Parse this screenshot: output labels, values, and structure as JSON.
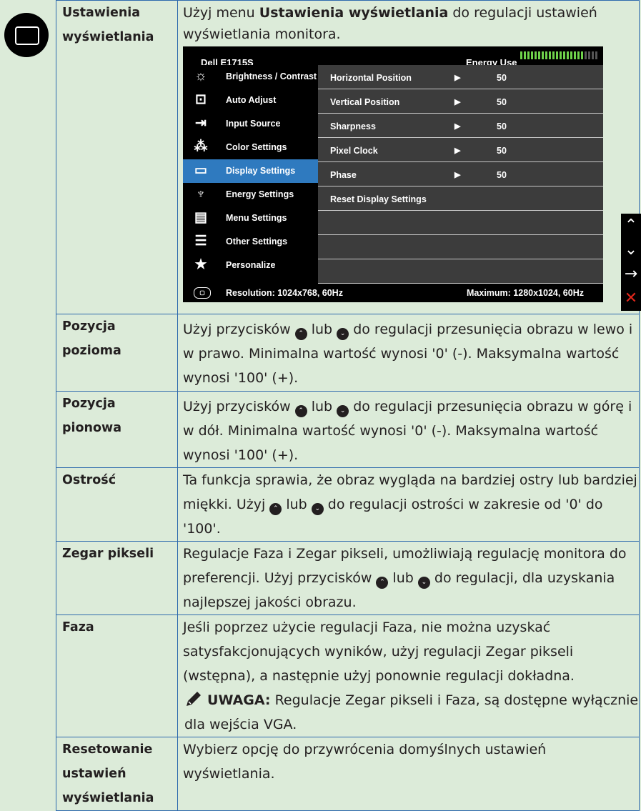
{
  "doc": {
    "rows": [
      {
        "label": "Ustawienia wyświetlania",
        "text_before": "Użyj menu ",
        "text_bold": "Ustawienia wyświetlania",
        "text_after": " do regulacji ustawień wyświetlania monitora."
      },
      {
        "label": "Pozycja pozioma",
        "a": "Użyj przycisków ",
        "b": " lub ",
        "c": " do regulacji przesunięcia obrazu w lewo i w prawo. Minimalna wartość wynosi '0' (-). Maksymalna wartość wynosi '100' (+)."
      },
      {
        "label": "Pozycja pionowa",
        "a": "Użyj przycisków ",
        "b": " lub ",
        "c": " do regulacji przesunięcia obrazu w górę i w dół. Minimalna wartość wynosi '0' (-). Maksymalna wartość wynosi '100' (+)."
      },
      {
        "label": "Ostrość",
        "a": "Ta funkcja sprawia, że obraz wygląda na bardziej ostry lub bardziej miękki. Użyj ",
        "b": " lub ",
        "c": " do regulacji ostrości w zakresie od '0' do '100'."
      },
      {
        "label": "Zegar pikseli",
        "a": "Regulacje Faza i Zegar pikseli, umożliwiają regulację monitora do preferencji. Użyj przycisków ",
        "b": " lub ",
        "c": " do regulacji, dla uzyskania najlepszej jakości obrazu."
      },
      {
        "label": "Faza",
        "text": "Jeśli poprzez użycie regulacji Faza, nie można uzyskać satysfakcjonujących wyników, użyj regulacji Zegar pikseli (wstępna), a następnie użyj ponownie regulacji dokładna.",
        "note_bold": "UWAGA:",
        "note_text": " Regulacje Zegar pikseli i Faza, są dostępne wyłącznie dla wejścia VGA."
      },
      {
        "label": "Resetowanie ustawień wyświetlania",
        "text": "Wybierz opcję do przywrócenia domyślnych ustawień wyświetlania."
      }
    ]
  },
  "osd": {
    "model": "Dell E1715S",
    "energy_label": "Energy Use",
    "energy_level": 0.8,
    "menu": [
      {
        "icon": "brightness-icon",
        "label": "Brightness / Contrast"
      },
      {
        "icon": "auto-adjust-icon",
        "label": "Auto Adjust"
      },
      {
        "icon": "input-source-icon",
        "label": "Input Source"
      },
      {
        "icon": "color-settings-icon",
        "label": "Color Settings"
      },
      {
        "icon": "display-settings-icon",
        "label": "Display Settings",
        "selected": true
      },
      {
        "icon": "energy-settings-icon",
        "label": "Energy Settings"
      },
      {
        "icon": "menu-settings-icon",
        "label": "Menu Settings"
      },
      {
        "icon": "other-settings-icon",
        "label": "Other Settings"
      },
      {
        "icon": "personalize-icon",
        "label": "Personalize"
      }
    ],
    "settings": [
      {
        "label": "Horizontal Position",
        "value": "50"
      },
      {
        "label": "Vertical Position",
        "value": "50"
      },
      {
        "label": "Sharpness",
        "value": "50"
      },
      {
        "label": "Pixel Clock",
        "value": "50"
      },
      {
        "label": "Phase",
        "value": "50"
      },
      {
        "label": "Reset Display Settings",
        "value": ""
      }
    ],
    "resolution": "Resolution: 1024x768, 60Hz",
    "maximum": "Maximum: 1280x1024, 60Hz",
    "arrow_glyph": "▶"
  },
  "side_keys": {
    "up": "^",
    "down": "v",
    "enter": "→",
    "exit": "✕"
  },
  "glyphs": {
    "up_dot": "⌃",
    "down_dot": "⌄"
  },
  "colors": {
    "page_bg": "#dcebd9",
    "border": "#2e6aad",
    "osd_selected": "#2f7abf",
    "exit_red": "#e0261b"
  }
}
